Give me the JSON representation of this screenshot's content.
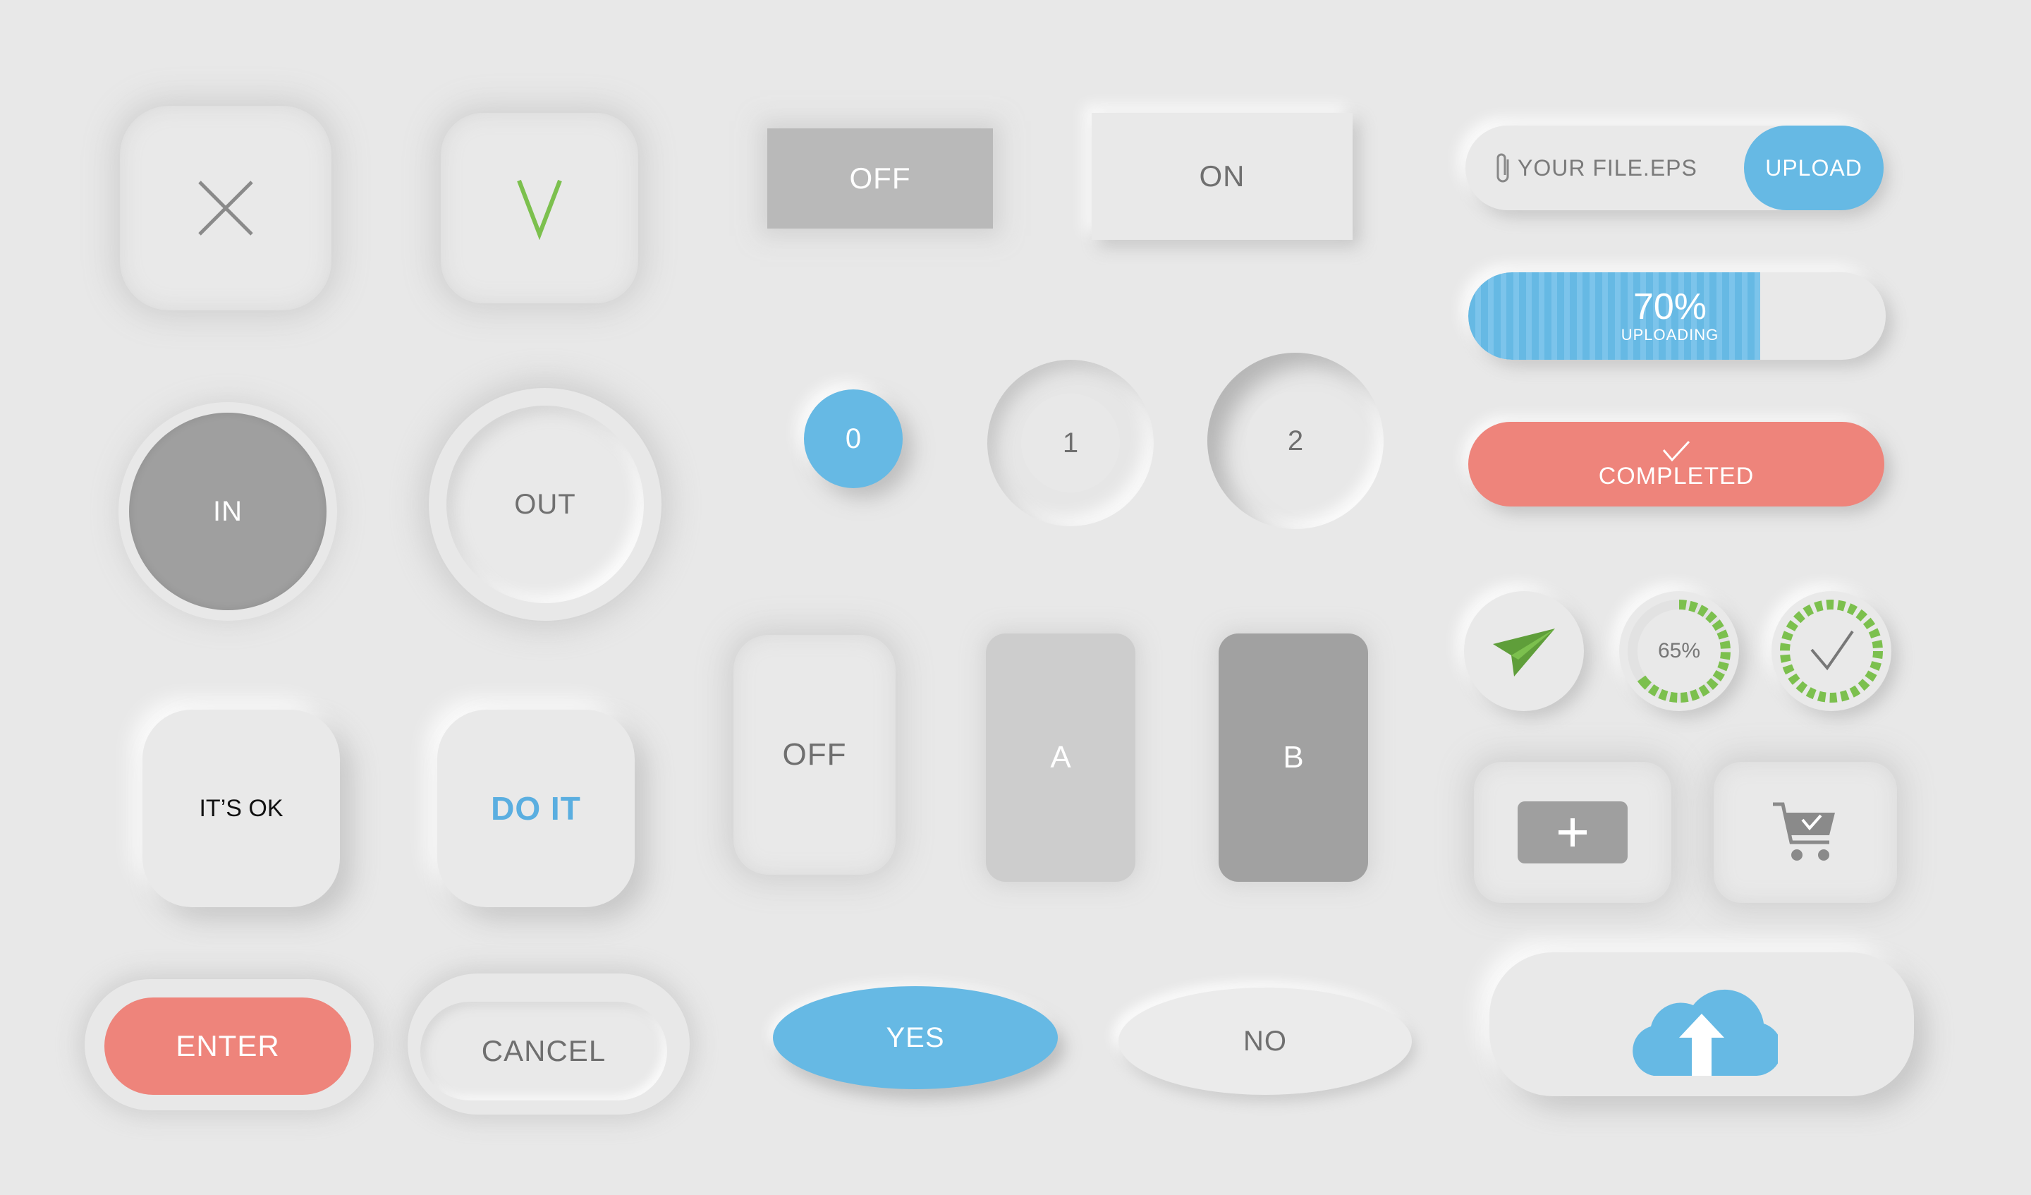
{
  "colors": {
    "background": "#e8e8e8",
    "accent_blue": "#66b9e4",
    "accent_red": "#ee847b",
    "accent_green": "#7cc04e",
    "gray_dark": "#a1a1a1",
    "gray_light": "#cdcdcd",
    "text_gray": "#6f6f6f"
  },
  "row1": {
    "off_label": "OFF",
    "on_label": "ON"
  },
  "row2": {
    "in_label": "IN",
    "out_label": "OUT",
    "step_0": "0",
    "step_1": "1",
    "step_2": "2"
  },
  "row3": {
    "its_ok_label": "IT’S OK",
    "do_it_label": "DO IT",
    "off_label": "OFF",
    "a_label": "A",
    "b_label": "B"
  },
  "row4": {
    "enter_label": "ENTER",
    "cancel_label": "CANCEL",
    "yes_label": "YES",
    "no_label": "NO"
  },
  "upload": {
    "file_placeholder": "YOUR FILE.EPS",
    "upload_label": "UPLOAD"
  },
  "progress": {
    "percent_label": "70%",
    "status_label": "UPLOADING",
    "value": 0.7
  },
  "completed": {
    "label": "COMPLETED"
  },
  "circular": {
    "percent_label": "65%",
    "value": 0.65
  },
  "icons": {
    "close": "close-icon",
    "check": "check-icon",
    "paperclip": "paperclip-icon",
    "send": "send-icon",
    "plus": "plus-icon",
    "cart": "cart-icon",
    "cloud_upload": "cloud-upload-icon"
  }
}
